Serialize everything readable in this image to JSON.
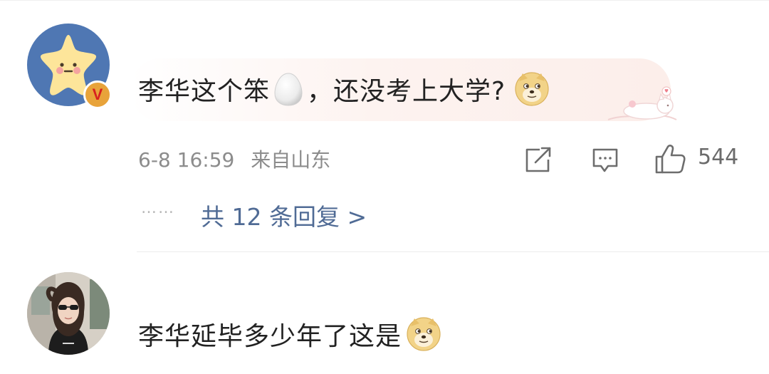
{
  "comments": [
    {
      "avatar": "star-avatar-icon",
      "badge": "V",
      "text_parts": [
        "李华这个笨",
        "，还没考上大学?"
      ],
      "inline_emojis": [
        "egg-emoji-icon",
        "doge-emoji-icon"
      ],
      "meta": {
        "date": "6-8 16:59",
        "location": "来自山东"
      },
      "actions": {
        "like_count": "544"
      },
      "replies": {
        "dots": "……",
        "label": "共 12 条回复 >"
      }
    },
    {
      "avatar": "girl-photo-avatar",
      "text_parts": [
        "李华延毕多少年了这是"
      ],
      "inline_emojis": [
        "doge-emoji-icon"
      ]
    }
  ],
  "colors": {
    "avatar_bg": "#4f77b3",
    "reply_link": "#506b95",
    "meta_text": "#8c8c8c",
    "body_text": "#222222",
    "badge": "#e8a33a"
  }
}
